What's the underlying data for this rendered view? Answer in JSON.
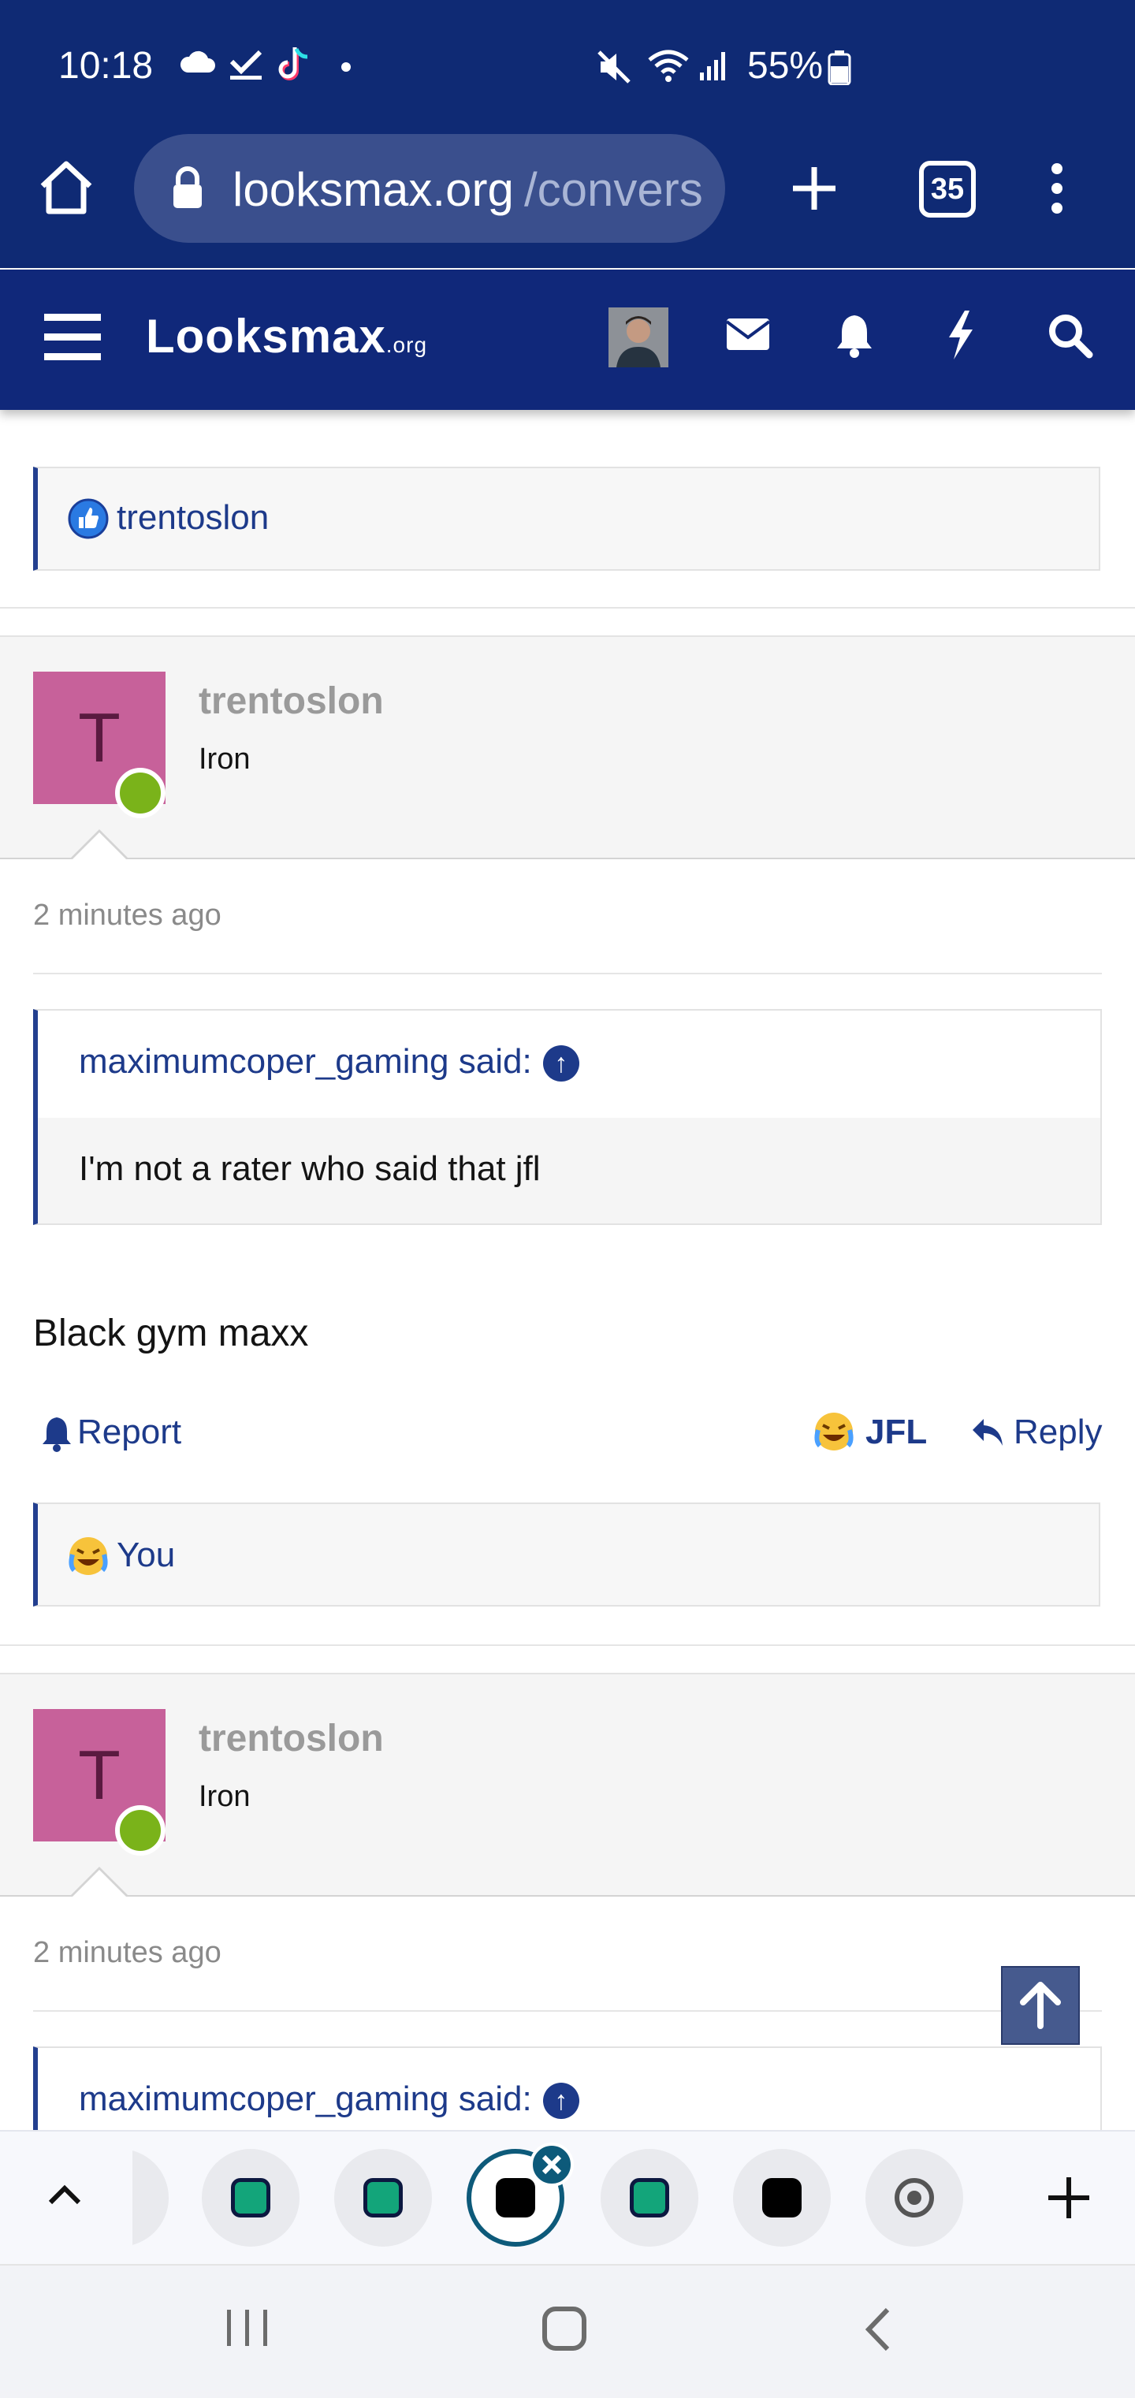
{
  "status_bar": {
    "time": "10:18",
    "battery": "55%",
    "icons": [
      "cloud-icon",
      "check-icon",
      "tiktok-icon",
      "dot-icon",
      "mute-icon",
      "wifi-icon",
      "signal-icon",
      "battery-icon"
    ]
  },
  "browser": {
    "url_host": "looksmax.org",
    "url_path": "/convers",
    "tab_count": "35"
  },
  "site_header": {
    "logo_main": "Looksmax",
    "logo_tld": ".org"
  },
  "top_reactions": {
    "user": "trentoslon"
  },
  "posts": [
    {
      "avatar_letter": "T",
      "username": "trentoslon",
      "user_title": "Iron",
      "time": "2 minutes ago",
      "quote_author": "maximumcoper_gaming said:",
      "quote_text": "I'm not a rater who said that jfl",
      "message": "Black gym maxx",
      "report_label": "Report",
      "reaction_label": "JFL",
      "reply_label": "Reply",
      "reactions_summary": "You"
    },
    {
      "avatar_letter": "T",
      "username": "trentoslon",
      "user_title": "Iron",
      "time": "2 minutes ago",
      "quote_author": "maximumcoper_gaming said:"
    }
  ],
  "colors": {
    "header_bg": "#10287a",
    "accent": "#1d3a8a",
    "avatar_bg": "#c7619a",
    "online": "#7ab31a"
  }
}
